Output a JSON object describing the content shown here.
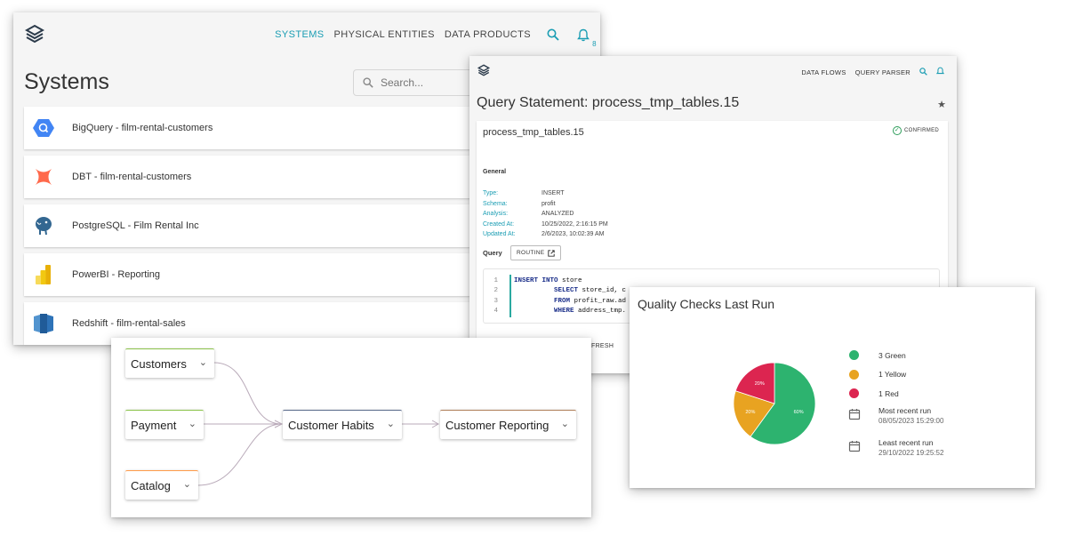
{
  "systems_panel": {
    "nav": [
      "SYSTEMS",
      "PHYSICAL ENTITIES",
      "DATA PRODUCTS"
    ],
    "notification_count": "8",
    "title": "Systems",
    "search_placeholder": "Search...",
    "items": [
      {
        "label": "BigQuery - film-rental-customers",
        "icon": "bigquery-icon",
        "color": "#4285f4"
      },
      {
        "label": "DBT - film-rental-customers",
        "icon": "dbt-icon",
        "color": "#ff694b"
      },
      {
        "label": "PostgreSQL - Film Rental Inc",
        "icon": "postgresql-icon",
        "color": "#336791"
      },
      {
        "label": "PowerBI - Reporting",
        "icon": "powerbi-icon",
        "color": "#f2c811"
      },
      {
        "label": "Redshift - film-rental-sales",
        "icon": "redshift-icon",
        "color": "#205b98"
      }
    ]
  },
  "query_panel": {
    "nav": [
      "DATA FLOWS",
      "QUERY PARSER"
    ],
    "title": "Query Statement: process_tmp_tables.15",
    "name": "process_tmp_tables.15",
    "status": "CONFIRMED",
    "section": "General",
    "props": [
      {
        "key": "Type:",
        "value": "INSERT"
      },
      {
        "key": "Schema:",
        "value": "profit"
      },
      {
        "key": "Analysis:",
        "value": "ANALYZED"
      },
      {
        "key": "Created At:",
        "value": "10/25/2022, 2:16:15 PM"
      },
      {
        "key": "Updated At:",
        "value": "2/6/2023, 10:02:39 AM"
      }
    ],
    "query_label": "Query",
    "routine_label": "ROUTINE",
    "code": [
      {
        "n": "1",
        "kw": "INSERT INTO",
        "rest": " store"
      },
      {
        "n": "2",
        "kw": "SELECT",
        "rest": " store_id, c"
      },
      {
        "n": "3",
        "kw": "FROM",
        "rest": " profit_raw.ad"
      },
      {
        "n": "4",
        "kw": "WHERE",
        "rest": " address_tmp."
      }
    ],
    "fresh_label": "FRESH"
  },
  "lineage_panel": {
    "nodes": [
      {
        "label": "Customers",
        "color": "#8bc34a"
      },
      {
        "label": "Payment",
        "color": "#8bc34a"
      },
      {
        "label": "Catalog",
        "color": "#ff9b4a"
      },
      {
        "label": "Customer Habits",
        "color": "#5a6b8c"
      },
      {
        "label": "Customer Reporting",
        "color": "#b0805a"
      }
    ]
  },
  "quality_panel": {
    "title": "Quality Checks Last Run",
    "chart_data": {
      "type": "pie",
      "categories": [
        "Green",
        "Yellow",
        "Red"
      ],
      "values": [
        60,
        20,
        20
      ],
      "labels": [
        "60%",
        "20%",
        "20%"
      ],
      "colors": [
        "#2db36f",
        "#e8a321",
        "#dc2550"
      ]
    },
    "legend": [
      {
        "label": "3 Green",
        "color": "#2db36f"
      },
      {
        "label": "1 Yellow",
        "color": "#e8a321"
      },
      {
        "label": "1 Red",
        "color": "#dc2550"
      }
    ],
    "most_recent_label": "Most recent run",
    "most_recent_value": "08/05/2023 15:29:00",
    "least_recent_label": "Least recent run",
    "least_recent_value": "29/10/2022 19:25:52"
  }
}
